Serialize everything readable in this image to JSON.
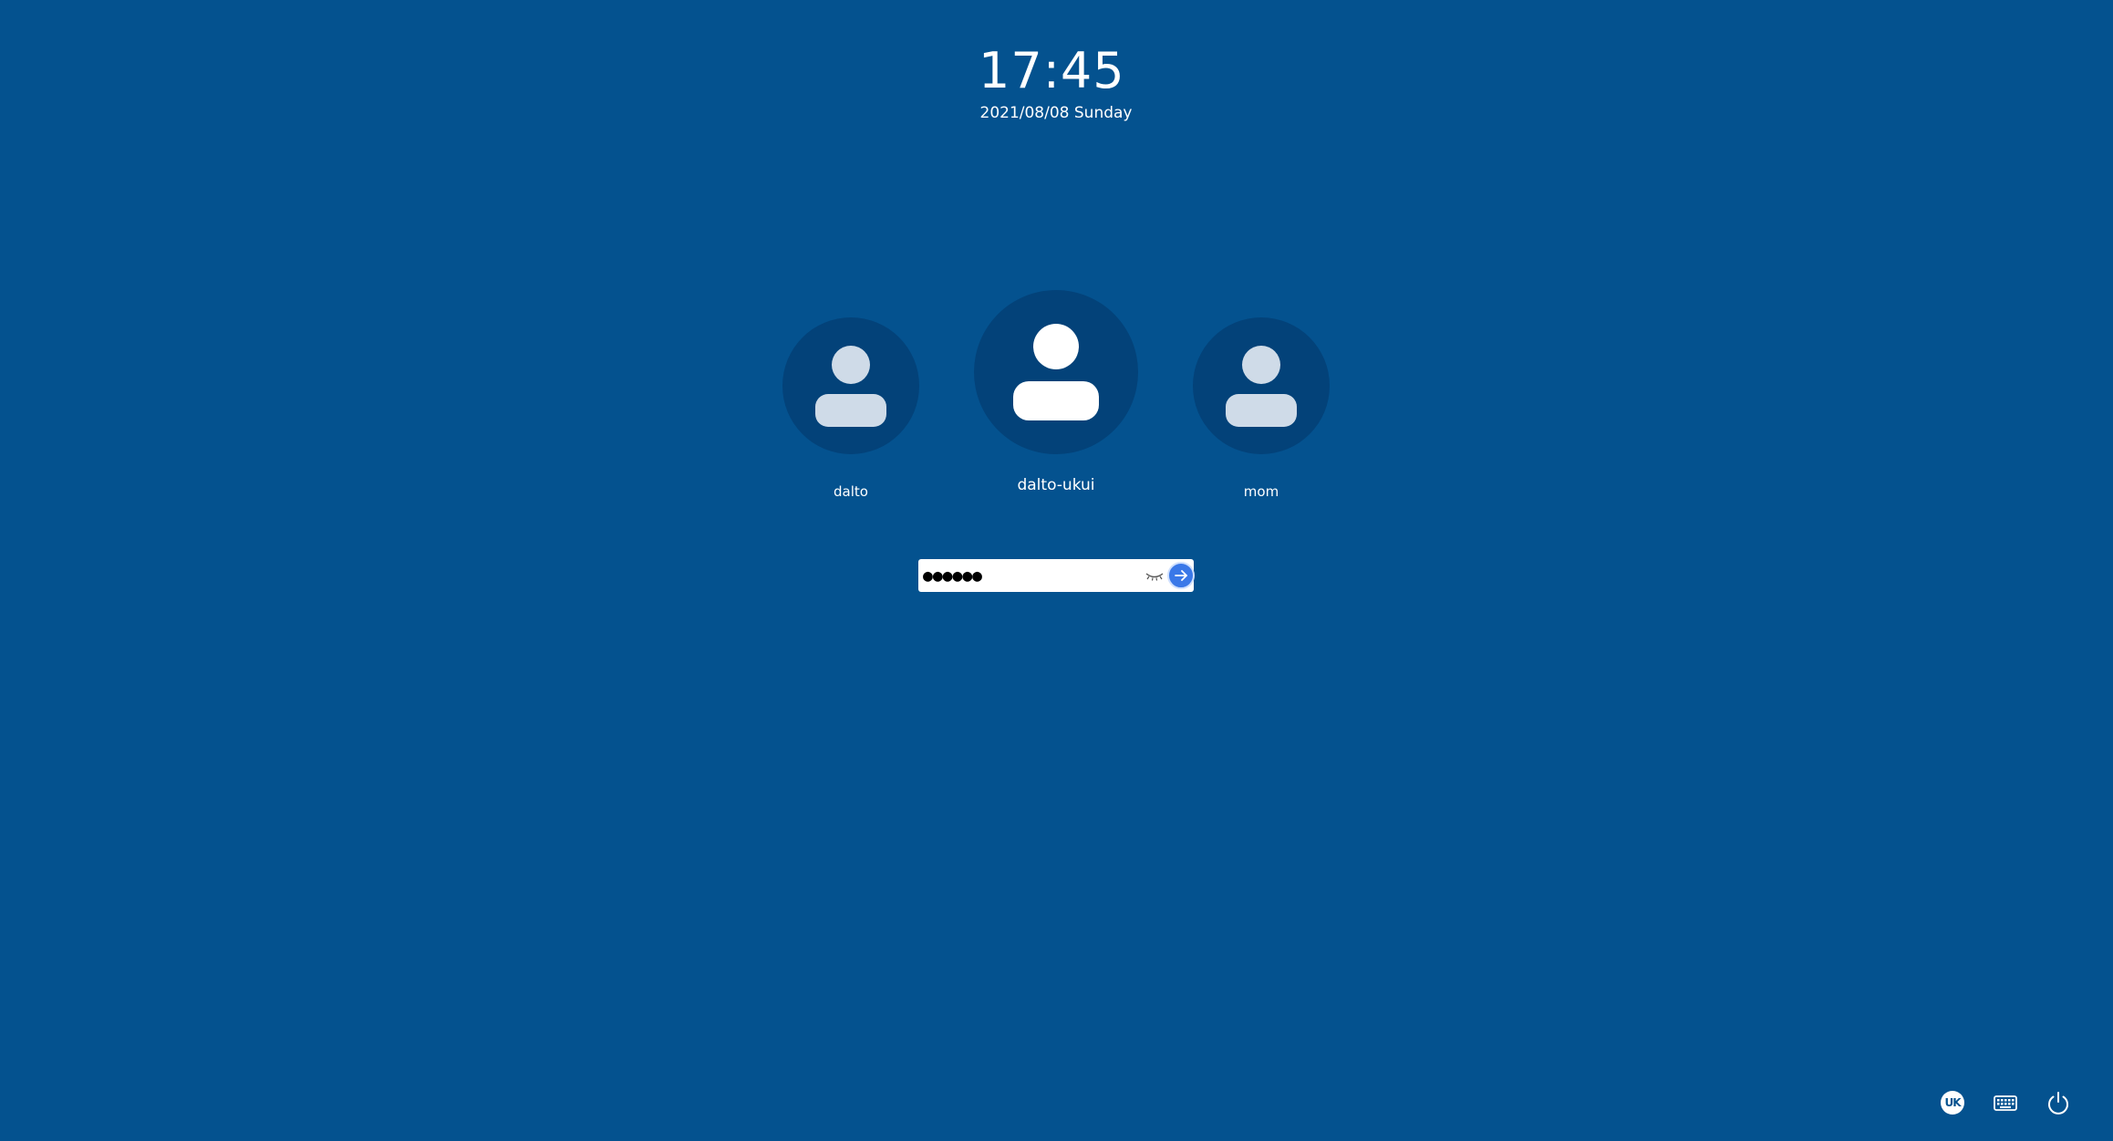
{
  "clock": {
    "time": "17:45",
    "date": "2021/08/08 Sunday"
  },
  "users": [
    {
      "name": "dalto",
      "icon": "user-icon",
      "selected": false
    },
    {
      "name": "dalto-ukui",
      "icon": "user-icon",
      "selected": true
    },
    {
      "name": "mom",
      "icon": "user-icon",
      "selected": false
    }
  ],
  "login": {
    "password_value": "●●●●●●",
    "toggle_icon": "eye-closed-icon",
    "submit_icon": "arrow-right-icon"
  },
  "bottom_bar": {
    "keyboard_layout": "UK",
    "keyboard_icon": "keyboard-icon",
    "power_icon": "power-icon"
  },
  "colors": {
    "background": "#04528f",
    "avatar_bg": "#034279",
    "accent": "#3a78e8"
  }
}
